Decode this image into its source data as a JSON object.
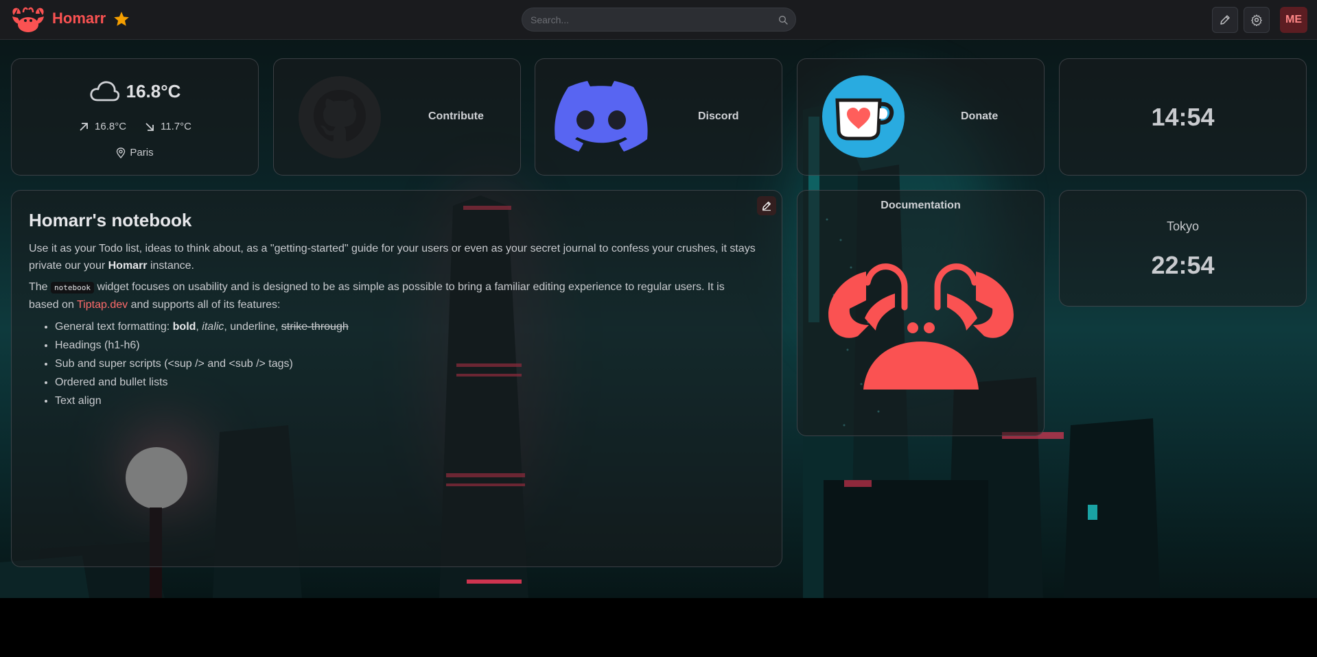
{
  "header": {
    "brand": "Homarr",
    "search_placeholder": "Search...",
    "avatar_initials": "ME"
  },
  "weather": {
    "temperature": "16.8°C",
    "high": "16.8°C",
    "low": "11.7°C",
    "location": "Paris"
  },
  "apps": {
    "contribute": "Contribute",
    "discord": "Discord",
    "donate": "Donate",
    "documentation": "Documentation"
  },
  "clocks": [
    {
      "time": "14:54"
    },
    {
      "city": "Tokyo",
      "time": "22:54"
    }
  ],
  "notebook": {
    "title": "Homarr's notebook",
    "p1_a": "Use it as your Todo list, ideas to think about, as a \"getting-started\" guide for your users or even as your secret journal to confess your crushes, it stays private our your ",
    "p1_bold": "Homarr",
    "p1_b": " instance.",
    "p2_a": "The ",
    "p2_code": "notebook",
    "p2_b": " widget focuses on usability and is designed to be as simple as possible to bring a familiar editing experience to regular users. It is based on ",
    "p2_link": "Tiptap.dev",
    "p2_c": " and supports all of its features:",
    "li1_a": "General text formatting: ",
    "li1_bold": "bold",
    "li1_sep1": ", ",
    "li1_italic": "italic",
    "li1_sep2": ", underline, ",
    "li1_strike": "strike-through",
    "li2": "Headings (h1-h6)",
    "li3": "Sub and super scripts (<sup /> and <sub /> tags)",
    "li4": "Ordered and bullet lists",
    "li5": "Text align"
  },
  "colors": {
    "brand": "#fa5252",
    "discord": "#5865f2",
    "kofi": "#29abe0"
  }
}
